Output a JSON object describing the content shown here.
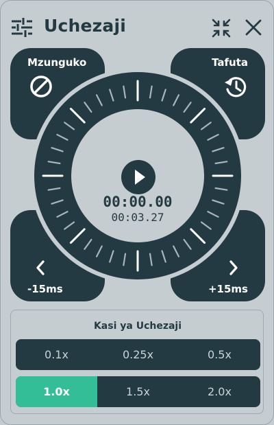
{
  "header": {
    "title": "Uchezaji",
    "icons": [
      "sliders-icon",
      "collapse-icon",
      "close-icon"
    ]
  },
  "corners": {
    "top_left": {
      "label": "Mzunguko",
      "icon": "no-loop-icon"
    },
    "top_right": {
      "label": "Tafuta",
      "icon": "history-seek-icon"
    },
    "bottom_left": {
      "label": "-15ms",
      "icon": "chevron-left-icon"
    },
    "bottom_right": {
      "label": "+15ms",
      "icon": "chevron-right-icon"
    }
  },
  "player": {
    "current_time": "00:00.00",
    "duration": "00:03.27",
    "icon": "play-icon"
  },
  "speed": {
    "title": "Kasi ya Uchezaji",
    "row1": [
      "0.1x",
      "0.25x",
      "0.5x"
    ],
    "row2": [
      "1.0x",
      "1.5x",
      "2.0x"
    ],
    "selected": "1.0x",
    "accent_color": "#33be97"
  },
  "colors": {
    "background": "#c5cdd0",
    "panel_dark": "#233a43"
  }
}
